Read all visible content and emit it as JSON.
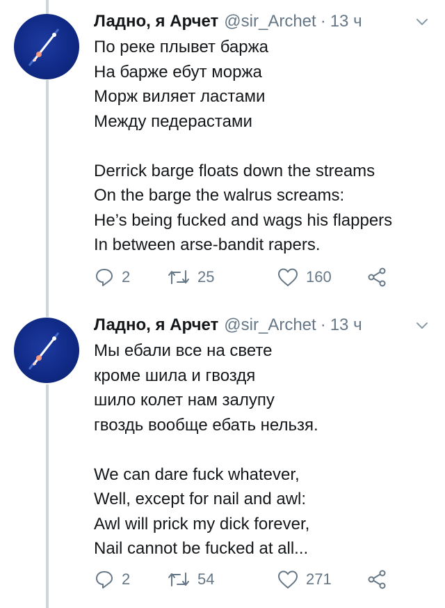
{
  "tweets": [
    {
      "author_name": "Ладно, я Арчет",
      "handle": "@sir_Archet",
      "separator": "·",
      "time": "13 ч",
      "lines": [
        "По реке плывет баржа",
        "На барже ебут моржа",
        "Морж виляет ластами",
        "Между педерастами",
        "",
        "Derrick barge floats down the streams",
        "On the barge the walrus screams:",
        "He’s being fucked and wags his flappers",
        "In between arse-bandit rapers."
      ],
      "replies": "2",
      "retweets": "25",
      "likes": "160"
    },
    {
      "author_name": "Ладно, я Арчет",
      "handle": "@sir_Archet",
      "separator": "·",
      "time": "13 ч",
      "lines": [
        "Мы ебали все на свете",
        "кроме шила и гвоздя",
        "шило колет нам залупу",
        "гвоздь вообще ебать нельзя.",
        "",
        "We can dare fuck whatever,",
        "Well, except for nail and awl:",
        "Awl will prick my dick forever,",
        "Nail cannot be fucked at all..."
      ],
      "replies": "2",
      "retweets": "54",
      "likes": "271"
    }
  ],
  "colors": {
    "text": "#14171a",
    "secondary": "#657786",
    "thread_line": "#ccd6dd",
    "avatar_bg": "#102a86"
  },
  "icons": [
    "reply-icon",
    "retweet-icon",
    "like-icon",
    "share-icon",
    "chevron-down-icon"
  ]
}
